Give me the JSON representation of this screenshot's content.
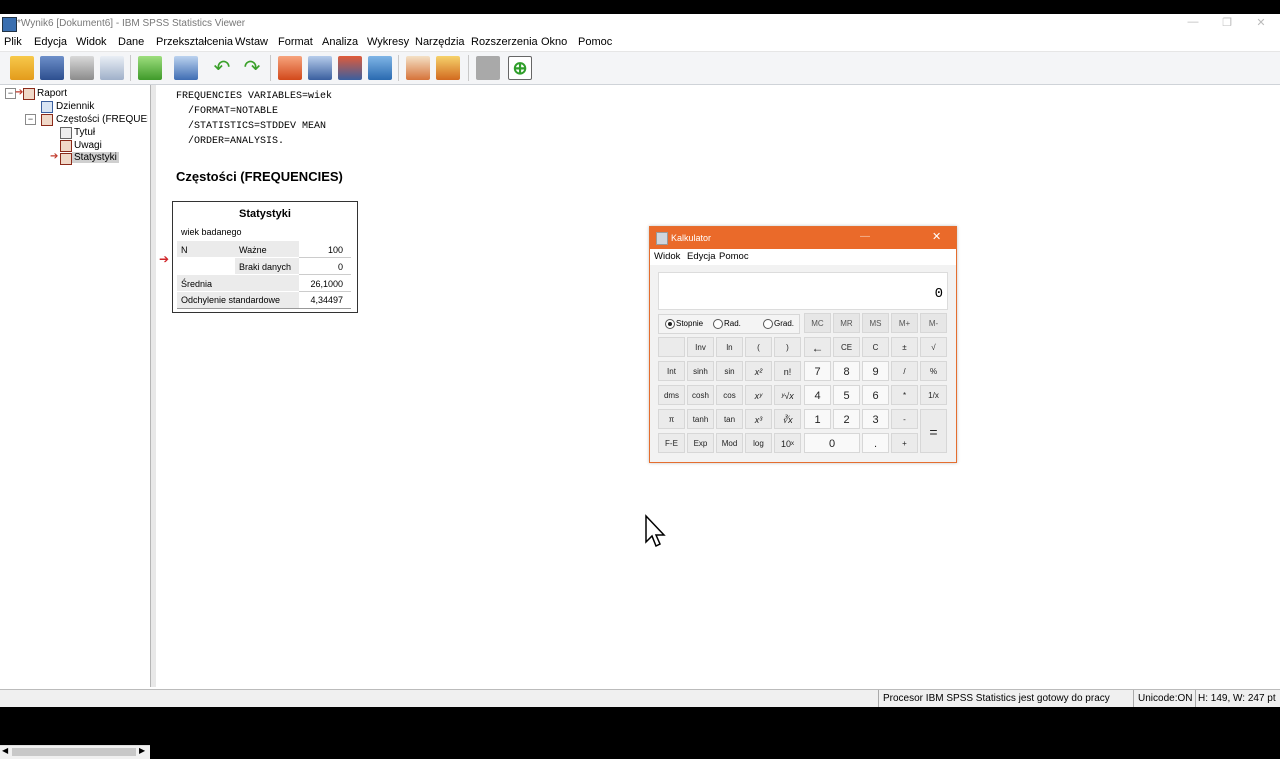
{
  "window": {
    "title": "*Wynik6 [Dokument6] - IBM SPSS Statistics Viewer",
    "controls": [
      "—",
      "❐",
      "✕"
    ]
  },
  "menu": [
    "Plik",
    "Edycja",
    "Widok",
    "Dane",
    "Przekształcenia",
    "Wstaw",
    "Format",
    "Analiza",
    "Wykresy",
    "Narzędzia",
    "Rozszerzenia",
    "Okno",
    "Pomoc"
  ],
  "toolbar_icons": [
    "open-icon",
    "save-icon",
    "print-icon",
    "print-preview-icon",
    "export-icon",
    "recall-dialog-icon",
    "undo-icon",
    "redo-icon",
    "goto-data-icon",
    "goto-case-icon",
    "goto-variable-icon",
    "variables-icon",
    "insert-output-icon",
    "designate-window-icon",
    "disabled-icon",
    "run-script-icon"
  ],
  "navigator": {
    "items": [
      {
        "label": "Raport"
      },
      {
        "label": "Dziennik"
      },
      {
        "label": "Częstości (FREQUENCIES)"
      },
      {
        "label": "Tytuł"
      },
      {
        "label": "Uwagi"
      },
      {
        "label": "Statystyki"
      }
    ]
  },
  "syntax": [
    "FREQUENCIES VARIABLES=wiek",
    "  /FORMAT=NOTABLE",
    "  /STATISTICS=STDDEV MEAN",
    "  /ORDER=ANALYSIS."
  ],
  "output": {
    "title": "Częstości (FREQUENCIES)",
    "table": {
      "caption": "Statystyki",
      "variable": "wiek badanego",
      "rows": [
        {
          "label": "N",
          "sublabel": "Ważne",
          "value": "100"
        },
        {
          "label": "",
          "sublabel": "Braki danych",
          "value": "0"
        },
        {
          "label": "Średnia",
          "sublabel": "",
          "value": "26,1000"
        },
        {
          "label": "Odchylenie standardowe",
          "sublabel": "",
          "value": "4,34497"
        }
      ]
    }
  },
  "calculator": {
    "title": "Kalkulator",
    "menu": [
      "Widok",
      "Edycja",
      "Pomoc"
    ],
    "display": "0",
    "angle_modes": [
      "Stopnie",
      "Rad.",
      "Grad."
    ],
    "angle_selected": "Stopnie",
    "memory": [
      "MC",
      "MR",
      "MS",
      "M+",
      "M-"
    ],
    "rows": [
      [
        "",
        "Inv",
        "ln",
        "(",
        ")",
        "←",
        "CE",
        "C",
        "±",
        "√"
      ],
      [
        "Int",
        "sinh",
        "sin",
        "x²",
        "n!",
        "7",
        "8",
        "9",
        "/",
        "%"
      ],
      [
        "dms",
        "cosh",
        "cos",
        "xʸ",
        "ʸ√x",
        "4",
        "5",
        "6",
        "*",
        "1/x"
      ],
      [
        "π",
        "tanh",
        "tan",
        "x³",
        "∛x",
        "1",
        "2",
        "3",
        "-",
        "="
      ],
      [
        "F-E",
        "Exp",
        "Mod",
        "log",
        "10ˣ",
        "0",
        ".",
        "+"
      ]
    ]
  },
  "status": {
    "processor": "Procesor IBM SPSS Statistics  jest gotowy do pracy",
    "unicode": "Unicode:ON",
    "size": "H: 149, W: 247 pt"
  }
}
